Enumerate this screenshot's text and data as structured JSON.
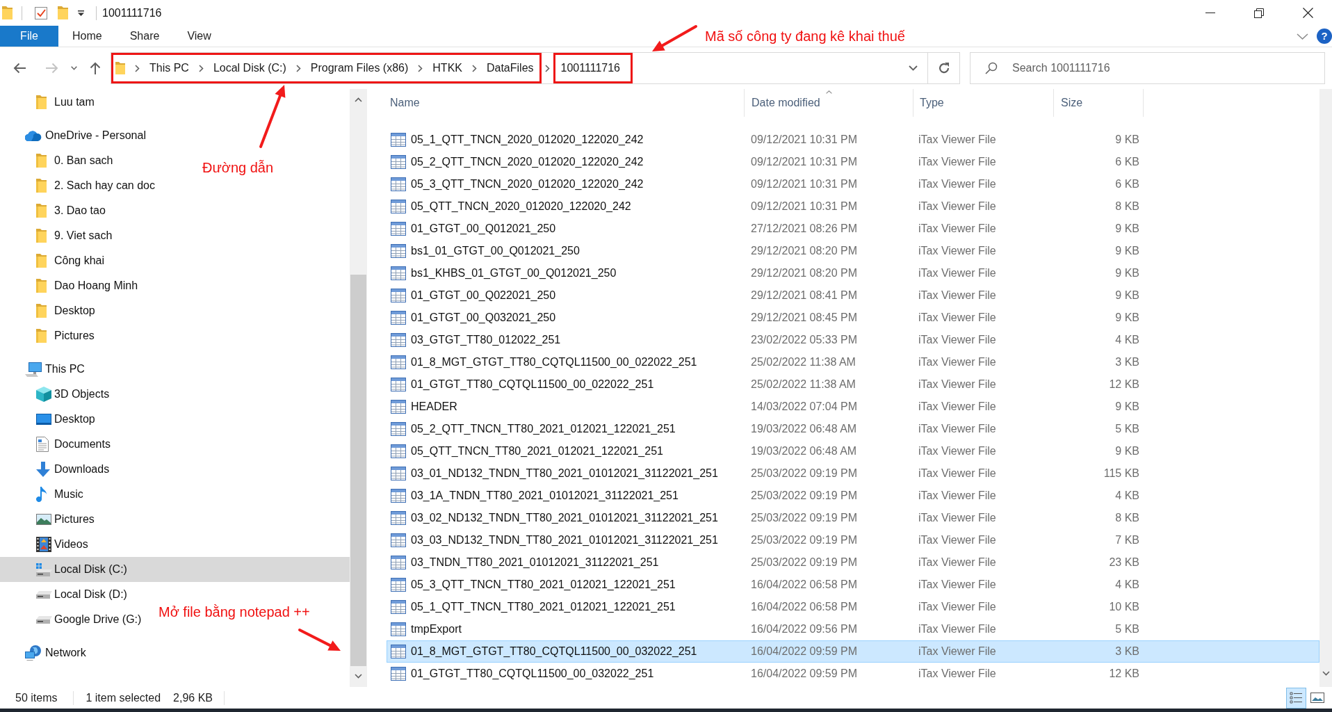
{
  "window": {
    "title": "1001111716"
  },
  "ribbon": {
    "tabs": [
      {
        "label": "File",
        "kind": "file"
      },
      {
        "label": "Home",
        "kind": "tab"
      },
      {
        "label": "Share",
        "kind": "tab"
      },
      {
        "label": "View",
        "kind": "tab"
      }
    ],
    "help": "?"
  },
  "address_bar": {
    "groups": [
      {
        "outlined": true,
        "segments": [
          "This PC",
          "Local Disk (C:)",
          "Program Files (x86)",
          "HTKK",
          "DataFiles"
        ]
      },
      {
        "outlined": true,
        "segments": [
          "1001111716"
        ]
      }
    ]
  },
  "search": {
    "placeholder": "Search 1001111716"
  },
  "navigation": {
    "groups": [
      {
        "children": [
          {
            "label": "Luu tam",
            "kind": "folder",
            "selected": false
          }
        ]
      },
      {
        "label": "OneDrive - Personal",
        "kind": "onedrive",
        "selected": false,
        "children": [
          {
            "label": "0. Ban sach",
            "kind": "folder",
            "selected": false
          },
          {
            "label": "2. Sach hay can doc",
            "kind": "folder",
            "selected": false
          },
          {
            "label": "3. Dao tao",
            "kind": "folder",
            "selected": false
          },
          {
            "label": "9. Viet sach",
            "kind": "folder",
            "selected": false
          },
          {
            "label": "Công khai",
            "kind": "folder",
            "selected": false
          },
          {
            "label": "Dao Hoang Minh",
            "kind": "folder",
            "selected": false
          },
          {
            "label": "Desktop",
            "kind": "folder",
            "selected": false
          },
          {
            "label": "Pictures",
            "kind": "folder",
            "selected": false
          }
        ]
      },
      {
        "label": "This PC",
        "kind": "pc",
        "selected": false,
        "children": [
          {
            "label": "3D Objects",
            "kind": "objects",
            "selected": false
          },
          {
            "label": "Desktop",
            "kind": "desktop",
            "selected": false
          },
          {
            "label": "Documents",
            "kind": "documents",
            "selected": false
          },
          {
            "label": "Downloads",
            "kind": "downloads",
            "selected": false
          },
          {
            "label": "Music",
            "kind": "music",
            "selected": false
          },
          {
            "label": "Pictures",
            "kind": "pictures",
            "selected": false
          },
          {
            "label": "Videos",
            "kind": "videos",
            "selected": false
          },
          {
            "label": "Local Disk (C:)",
            "kind": "systemdrive",
            "selected": true
          },
          {
            "label": "Local Disk (D:)",
            "kind": "drive",
            "selected": false
          },
          {
            "label": "Google Drive (G:)",
            "kind": "drive",
            "selected": false
          }
        ]
      },
      {
        "label": "Network",
        "kind": "network",
        "selected": false
      }
    ]
  },
  "file_list": {
    "columns": [
      {
        "label": "Name",
        "sorted": false
      },
      {
        "label": "Date modified",
        "sorted": true
      },
      {
        "label": "Type",
        "sorted": false
      },
      {
        "label": "Size",
        "sorted": false
      }
    ],
    "rows": [
      {
        "name": "05_1_QTT_TNCN_2020_012020_122020_242",
        "date": "09/12/2021 10:31 PM",
        "type": "iTax Viewer File",
        "size": "9 KB",
        "selected": false
      },
      {
        "name": "05_2_QTT_TNCN_2020_012020_122020_242",
        "date": "09/12/2021 10:31 PM",
        "type": "iTax Viewer File",
        "size": "6 KB",
        "selected": false
      },
      {
        "name": "05_3_QTT_TNCN_2020_012020_122020_242",
        "date": "09/12/2021 10:31 PM",
        "type": "iTax Viewer File",
        "size": "6 KB",
        "selected": false
      },
      {
        "name": "05_QTT_TNCN_2020_012020_122020_242",
        "date": "09/12/2021 10:31 PM",
        "type": "iTax Viewer File",
        "size": "8 KB",
        "selected": false
      },
      {
        "name": "01_GTGT_00_Q012021_250",
        "date": "27/12/2021 08:26 PM",
        "type": "iTax Viewer File",
        "size": "9 KB",
        "selected": false
      },
      {
        "name": "bs1_01_GTGT_00_Q012021_250",
        "date": "29/12/2021 08:20 PM",
        "type": "iTax Viewer File",
        "size": "9 KB",
        "selected": false
      },
      {
        "name": "bs1_KHBS_01_GTGT_00_Q012021_250",
        "date": "29/12/2021 08:20 PM",
        "type": "iTax Viewer File",
        "size": "9 KB",
        "selected": false
      },
      {
        "name": "01_GTGT_00_Q022021_250",
        "date": "29/12/2021 08:41 PM",
        "type": "iTax Viewer File",
        "size": "9 KB",
        "selected": false
      },
      {
        "name": "01_GTGT_00_Q032021_250",
        "date": "29/12/2021 08:45 PM",
        "type": "iTax Viewer File",
        "size": "9 KB",
        "selected": false
      },
      {
        "name": "03_GTGT_TT80_012022_251",
        "date": "23/02/2022 05:33 PM",
        "type": "iTax Viewer File",
        "size": "4 KB",
        "selected": false
      },
      {
        "name": "01_8_MGT_GTGT_TT80_CQTQL11500_00_022022_251",
        "date": "25/02/2022 11:38 AM",
        "type": "iTax Viewer File",
        "size": "3 KB",
        "selected": false
      },
      {
        "name": "01_GTGT_TT80_CQTQL11500_00_022022_251",
        "date": "25/02/2022 11:38 AM",
        "type": "iTax Viewer File",
        "size": "12 KB",
        "selected": false
      },
      {
        "name": "HEADER",
        "date": "14/03/2022 07:04 PM",
        "type": "iTax Viewer File",
        "size": "9 KB",
        "selected": false
      },
      {
        "name": "05_2_QTT_TNCN_TT80_2021_012021_122021_251",
        "date": "19/03/2022 06:48 AM",
        "type": "iTax Viewer File",
        "size": "5 KB",
        "selected": false
      },
      {
        "name": "05_QTT_TNCN_TT80_2021_012021_122021_251",
        "date": "19/03/2022 06:48 AM",
        "type": "iTax Viewer File",
        "size": "9 KB",
        "selected": false
      },
      {
        "name": "03_01_ND132_TNDN_TT80_2021_01012021_31122021_251",
        "date": "25/03/2022 09:19 PM",
        "type": "iTax Viewer File",
        "size": "115 KB",
        "selected": false
      },
      {
        "name": "03_1A_TNDN_TT80_2021_01012021_31122021_251",
        "date": "25/03/2022 09:19 PM",
        "type": "iTax Viewer File",
        "size": "4 KB",
        "selected": false
      },
      {
        "name": "03_02_ND132_TNDN_TT80_2021_01012021_31122021_251",
        "date": "25/03/2022 09:19 PM",
        "type": "iTax Viewer File",
        "size": "8 KB",
        "selected": false
      },
      {
        "name": "03_03_ND132_TNDN_TT80_2021_01012021_31122021_251",
        "date": "25/03/2022 09:19 PM",
        "type": "iTax Viewer File",
        "size": "7 KB",
        "selected": false
      },
      {
        "name": "03_TNDN_TT80_2021_01012021_31122021_251",
        "date": "25/03/2022 09:19 PM",
        "type": "iTax Viewer File",
        "size": "23 KB",
        "selected": false
      },
      {
        "name": "05_3_QTT_TNCN_TT80_2021_012021_122021_251",
        "date": "16/04/2022 06:58 PM",
        "type": "iTax Viewer File",
        "size": "4 KB",
        "selected": false
      },
      {
        "name": "05_1_QTT_TNCN_TT80_2021_012021_122021_251",
        "date": "16/04/2022 06:58 PM",
        "type": "iTax Viewer File",
        "size": "10 KB",
        "selected": false
      },
      {
        "name": "tmpExport",
        "date": "16/04/2022 09:56 PM",
        "type": "iTax Viewer File",
        "size": "5 KB",
        "selected": false
      },
      {
        "name": "01_8_MGT_GTGT_TT80_CQTQL11500_00_032022_251",
        "date": "16/04/2022 09:59 PM",
        "type": "iTax Viewer File",
        "size": "3 KB",
        "selected": true
      },
      {
        "name": "01_GTGT_TT80_CQTQL11500_00_032022_251",
        "date": "16/04/2022 09:59 PM",
        "type": "iTax Viewer File",
        "size": "12 KB",
        "selected": false
      }
    ]
  },
  "status_bar": {
    "item_count": "50 items",
    "selection": "1 item selected",
    "selection_size": "2,96 KB"
  },
  "view_buttons": [
    {
      "kind": "details",
      "selected": true
    },
    {
      "kind": "large-icons",
      "selected": false
    }
  ],
  "annotations": [
    {
      "text": "Mã số công ty đang kê khai thuế"
    },
    {
      "text": "Đường dẫn"
    },
    {
      "text": "Mở file bằng notepad ++"
    }
  ]
}
